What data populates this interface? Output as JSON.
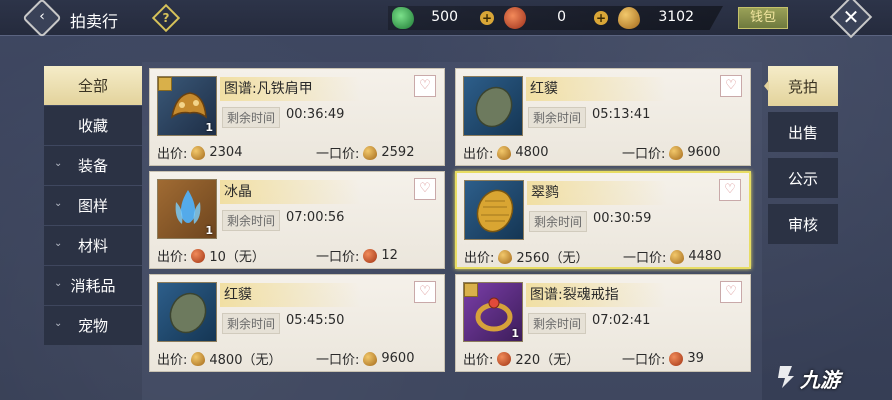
{
  "header": {
    "title": "拍卖行",
    "help": "?",
    "currencies": [
      {
        "icon": "jade-icon",
        "value": "500"
      },
      {
        "icon": "red-gem-icon",
        "value": "0"
      },
      {
        "icon": "gold-coin-icon",
        "value": "3102"
      }
    ],
    "plus": "+",
    "wallet_label": "钱包",
    "close": "✕",
    "back": "‹"
  },
  "left_menu": [
    {
      "label": "全部",
      "active": true
    },
    {
      "label": "收藏"
    },
    {
      "label": "装备",
      "expandable": true
    },
    {
      "label": "图样",
      "expandable": true
    },
    {
      "label": "材料",
      "expandable": true
    },
    {
      "label": "消耗品",
      "expandable": true
    },
    {
      "label": "宠物",
      "expandable": true
    }
  ],
  "right_menu": [
    {
      "label": "竞拍",
      "active": true
    },
    {
      "label": "出售"
    },
    {
      "label": "公示"
    },
    {
      "label": "审核"
    }
  ],
  "labels": {
    "remaining": "剩余时间",
    "bid": "出价:",
    "buyout": "一口价:",
    "chev": "⌄",
    "heart": "♡"
  },
  "cards": [
    {
      "name": "图谱:凡铁肩甲",
      "qty": "1",
      "time": "00:36:49",
      "bid": "2304",
      "buyout": "2592",
      "currency": "gold"
    },
    {
      "name": "红貘",
      "qty": "",
      "time": "05:13:41",
      "bid": "4800",
      "buyout": "9600",
      "currency": "gold"
    },
    {
      "name": "冰晶",
      "qty": "1",
      "time": "07:00:56",
      "bid": "10（无）",
      "buyout": "12",
      "currency": "red"
    },
    {
      "name": "翠鹨",
      "qty": "",
      "time": "00:30:59",
      "bid": "2560（无）",
      "buyout": "4480",
      "currency": "gold",
      "selected": true
    },
    {
      "name": "红貘",
      "qty": "",
      "time": "05:45:50",
      "bid": "4800（无）",
      "buyout": "9600",
      "currency": "gold"
    },
    {
      "name": "图谱:裂魂戒指",
      "qty": "1",
      "time": "07:02:41",
      "bid": "220（无）",
      "buyout": "39",
      "currency": "red"
    }
  ],
  "watermark": "九游"
}
